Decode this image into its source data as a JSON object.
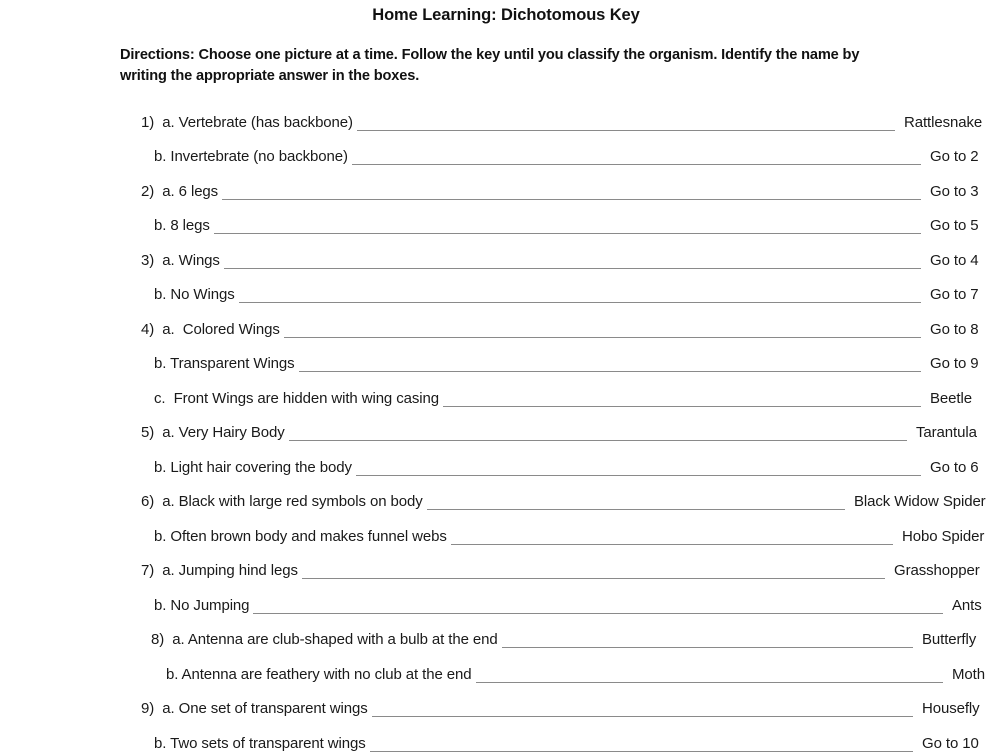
{
  "document": {
    "title": "Home Learning: Dichotomous Key",
    "directions": "Directions: Choose one picture at a time. Follow the key until you classify the organism. Identify the name by writing the appropriate answer in the boxes."
  },
  "key": {
    "rows": [
      {
        "label": "1)  a. Vertebrate (has backbone)",
        "answer": "Rattlesnake",
        "indent": "a",
        "answer_width": 96
      },
      {
        "label": "b. Invertebrate (no backbone)",
        "answer": "Go to 2",
        "indent": "b",
        "answer_width": 70
      },
      {
        "label": "2)  a. 6 legs",
        "answer": "Go to 3",
        "indent": "a",
        "answer_width": 70
      },
      {
        "label": "b. 8 legs",
        "answer": "Go to 5",
        "indent": "b",
        "answer_width": 70
      },
      {
        "label": "3)  a. Wings",
        "answer": "Go to 4",
        "indent": "a",
        "answer_width": 70
      },
      {
        "label": "b. No Wings",
        "answer": "Go to 7",
        "indent": "b",
        "answer_width": 70
      },
      {
        "label": "4)  a.  Colored Wings",
        "answer": "Go to 8",
        "indent": "a",
        "answer_width": 70
      },
      {
        "label": "b. Transparent Wings",
        "answer": "Go to 9",
        "indent": "b",
        "answer_width": 70
      },
      {
        "label": "c.  Front Wings are hidden with wing casing",
        "answer": "Beetle",
        "indent": "b",
        "answer_width": 70
      },
      {
        "label": "5)  a. Very Hairy Body",
        "answer": "Tarantula",
        "indent": "a",
        "answer_width": 84
      },
      {
        "label": "b. Light hair covering the body",
        "answer": "Go to 6",
        "indent": "b",
        "answer_width": 70
      },
      {
        "label": "6)  a. Black with large red symbols on body",
        "answer": "Black Widow Spider",
        "indent": "a",
        "answer_width": 146
      },
      {
        "label": "b. Often brown body and makes funnel webs",
        "answer": "Hobo Spider",
        "indent": "b",
        "answer_width": 98
      },
      {
        "label": "7)  a. Jumping hind legs",
        "answer": "Grasshopper",
        "indent": "a",
        "answer_width": 106
      },
      {
        "label": "b. No Jumping",
        "answer": "Ants",
        "indent": "b",
        "answer_width": 48
      },
      {
        "label": "8)  a. Antenna are club-shaped with a bulb at the end",
        "answer": "Butterfly",
        "indent": "a2",
        "answer_width": 78
      },
      {
        "label": "b. Antenna are feathery with no club at the end",
        "answer": "Moth",
        "indent": "b2",
        "answer_width": 48
      },
      {
        "label": "9)  a. One set of transparent wings",
        "answer": "Housefly",
        "indent": "a",
        "answer_width": 78
      },
      {
        "label": "b. Two sets of transparent wings",
        "answer": "Go to 10",
        "indent": "b",
        "answer_width": 78
      }
    ]
  },
  "colors": {
    "page_background": "#ffffff",
    "text": "#1a1a1a",
    "rule": "#8a8a8a"
  }
}
